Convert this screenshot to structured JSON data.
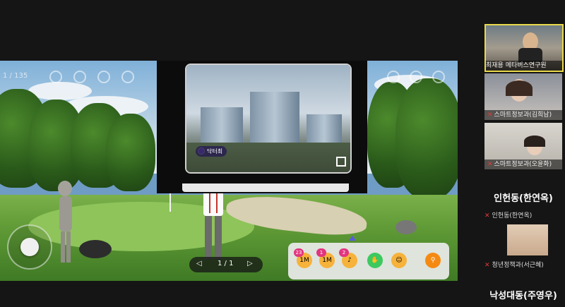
{
  "scene": {
    "counter_text": "1 / 135",
    "tag_label": "닥터최",
    "pager": {
      "prev_icon": "triangle-left",
      "text": "1 / 1",
      "next_icon": "triangle-right"
    },
    "emotes": [
      {
        "badge": "23",
        "extra": "1M",
        "icon": "emoji-laugh"
      },
      {
        "badge": "1",
        "extra": "1M",
        "icon": "emoji-laugh"
      },
      {
        "badge": "2",
        "extra": "",
        "icon": "emoji-music"
      },
      {
        "badge": "",
        "extra": "",
        "icon": "hand-raise-icon"
      },
      {
        "badge": "",
        "extra": "",
        "icon": "emoji-hug"
      }
    ]
  },
  "participants": {
    "tiles": [
      {
        "name": "최재용 메타버스연구원",
        "active": true,
        "muted": false
      },
      {
        "name": "스마트정보과(김희남)",
        "active": false,
        "muted": true
      },
      {
        "name": "스마트정보과(오윤화)",
        "active": false,
        "muted": true
      }
    ],
    "names": [
      {
        "big": "인헌동(한연옥)",
        "small": "인헌동(한연옥)"
      },
      {
        "big": "",
        "small": "청년정책과(서근혜)"
      },
      {
        "big": "낙성대동(주영우)",
        "small": ""
      }
    ]
  },
  "colors": {
    "active_border": "#e9d94a",
    "mic_muted": "#e03a3a",
    "badge": "#e2357f"
  }
}
